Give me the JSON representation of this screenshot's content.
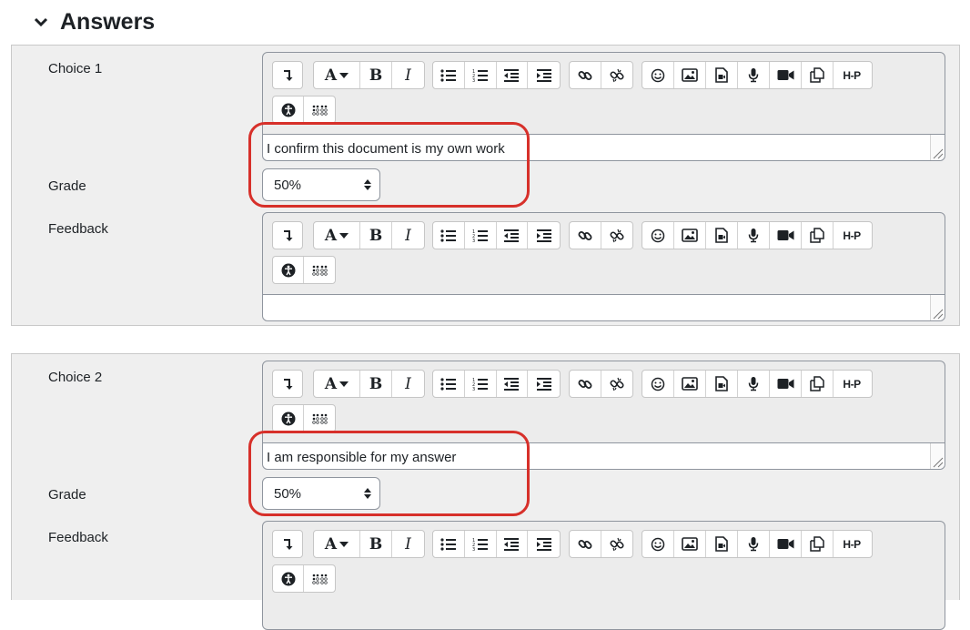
{
  "section": {
    "title": "Answers",
    "toggle_icon": "chevron-down-icon"
  },
  "choices": [
    {
      "choice_label": "Choice 1",
      "answer_text": "I confirm this document is my own work",
      "grade_label": "Grade",
      "grade_value": "50%",
      "feedback_label": "Feedback",
      "feedback_text": ""
    },
    {
      "choice_label": "Choice 2",
      "answer_text": "I am responsible for my answer",
      "grade_label": "Grade",
      "grade_value": "50%",
      "feedback_label": "Feedback",
      "feedback_text": ""
    }
  ],
  "toolbar_icons": [
    "collapse-icon",
    "font-style-icon",
    "bold-icon",
    "italic-icon",
    "unordered-list-icon",
    "ordered-list-icon",
    "outdent-icon",
    "indent-icon",
    "link-icon",
    "unlink-icon",
    "emoji-icon",
    "image-icon",
    "media-icon",
    "record-audio-icon",
    "record-video-icon",
    "manage-files-icon",
    "h5p-icon",
    "accessibility-checker-icon",
    "screenreader-helper-icon"
  ],
  "toolbar_text": {
    "bold": "B",
    "italic": "I",
    "h5p": "H-P",
    "font": "A"
  },
  "highlight_color": "#d7302a"
}
